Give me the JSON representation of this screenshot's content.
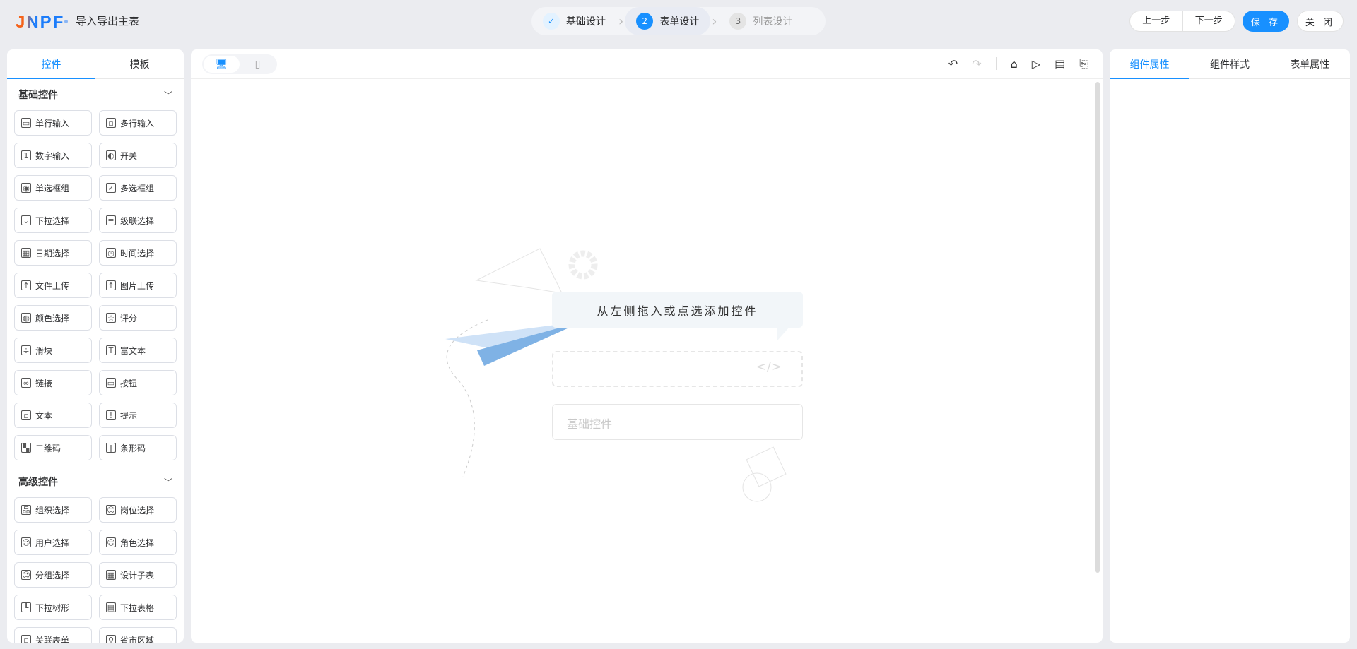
{
  "header": {
    "logo": "JNPF",
    "title": "导入导出主表",
    "steps": [
      {
        "num": "✓",
        "label": "基础设计",
        "state": "done"
      },
      {
        "num": "2",
        "label": "表单设计",
        "state": "active"
      },
      {
        "num": "3",
        "label": "列表设计",
        "state": "todo"
      }
    ],
    "prev": "上一步",
    "next": "下一步",
    "save": "保 存",
    "close": "关 闭"
  },
  "left": {
    "tabs": [
      "控件",
      "模板"
    ],
    "basic_title": "基础控件",
    "basic": [
      {
        "icon": "▭",
        "label": "单行输入"
      },
      {
        "icon": "▫",
        "label": "多行输入"
      },
      {
        "icon": "1",
        "label": "数字输入"
      },
      {
        "icon": "◐",
        "label": "开关"
      },
      {
        "icon": "◉",
        "label": "单选框组"
      },
      {
        "icon": "✓",
        "label": "多选框组"
      },
      {
        "icon": "⌄",
        "label": "下拉选择"
      },
      {
        "icon": "≡",
        "label": "级联选择"
      },
      {
        "icon": "▦",
        "label": "日期选择"
      },
      {
        "icon": "◷",
        "label": "时间选择"
      },
      {
        "icon": "↑",
        "label": "文件上传"
      },
      {
        "icon": "↑",
        "label": "图片上传"
      },
      {
        "icon": "◍",
        "label": "颜色选择"
      },
      {
        "icon": "☆",
        "label": "评分"
      },
      {
        "icon": "≑",
        "label": "滑块"
      },
      {
        "icon": "T",
        "label": "富文本"
      },
      {
        "icon": "∞",
        "label": "链接"
      },
      {
        "icon": "▭",
        "label": "按钮"
      },
      {
        "icon": "▫",
        "label": "文本"
      },
      {
        "icon": "!",
        "label": "提示"
      },
      {
        "icon": "▚",
        "label": "二维码"
      },
      {
        "icon": "‖",
        "label": "条形码"
      }
    ],
    "advanced_title": "高级控件",
    "advanced": [
      {
        "icon": "品",
        "label": "组织选择"
      },
      {
        "icon": "☺",
        "label": "岗位选择"
      },
      {
        "icon": "☺",
        "label": "用户选择"
      },
      {
        "icon": "☺",
        "label": "角色选择"
      },
      {
        "icon": "☺",
        "label": "分组选择"
      },
      {
        "icon": "▦",
        "label": "设计子表"
      },
      {
        "icon": "┗",
        "label": "下拉树形"
      },
      {
        "icon": "▤",
        "label": "下拉表格"
      },
      {
        "icon": "▫",
        "label": "关联表单"
      },
      {
        "icon": "⚲",
        "label": "省市区域"
      }
    ]
  },
  "canvas": {
    "empty_hint": "从左侧拖入或点选添加控件",
    "placeholder": "基础控件",
    "code_icon": "</>"
  },
  "right": {
    "tabs": [
      "组件属性",
      "组件样式",
      "表单属性"
    ]
  }
}
